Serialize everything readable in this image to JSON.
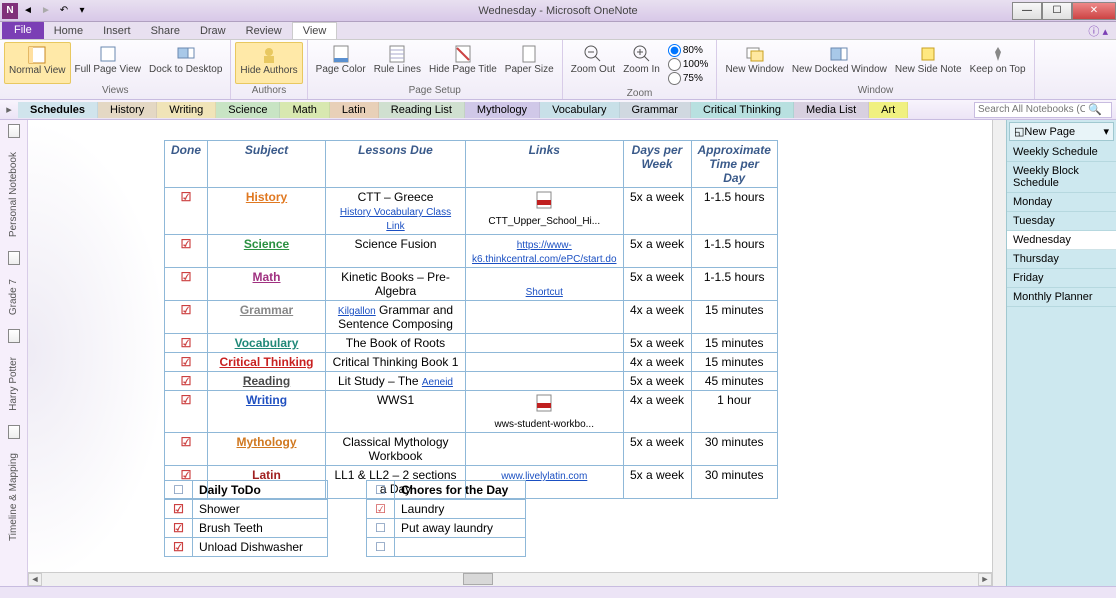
{
  "app": {
    "title": "Wednesday - Microsoft OneNote"
  },
  "qat": {
    "back_icon": "back",
    "fwd_icon": "fwd"
  },
  "ribbon_tabs": {
    "file": "File",
    "home": "Home",
    "insert": "Insert",
    "share": "Share",
    "draw": "Draw",
    "review": "Review",
    "view": "View"
  },
  "ribbon": {
    "views": {
      "normal": "Normal View",
      "fullpage": "Full Page View",
      "dock": "Dock to Desktop",
      "group": "Views"
    },
    "authors": {
      "hide": "Hide Authors",
      "group": "Authors"
    },
    "pagesetup": {
      "pagecolor": "Page Color",
      "rulelines": "Rule Lines",
      "hidetitle": "Hide Page Title",
      "papersize": "Paper Size",
      "group": "Page Setup"
    },
    "zoom": {
      "out": "Zoom Out",
      "in": "Zoom In",
      "z80": "80%",
      "z100": "100%",
      "z75": "75%",
      "group": "Zoom"
    },
    "window": {
      "newwin": "New Window",
      "docked": "New Docked Window",
      "sidenote": "New Side Note",
      "ontop": "Keep on Top",
      "group": "Window"
    }
  },
  "notebook_tabs": [
    {
      "label": "Schedules",
      "color": "#d0e4ec"
    },
    {
      "label": "History",
      "color": "#e4d8c4"
    },
    {
      "label": "Writing",
      "color": "#f0e4b8"
    },
    {
      "label": "Science",
      "color": "#c8e4c4"
    },
    {
      "label": "Math",
      "color": "#d8e8b0"
    },
    {
      "label": "Latin",
      "color": "#e8d0b8"
    },
    {
      "label": "Reading List",
      "color": "#d0e0d0"
    },
    {
      "label": "Mythology",
      "color": "#d0c8e8"
    },
    {
      "label": "Vocabulary",
      "color": "#c8e0e8"
    },
    {
      "label": "Grammar",
      "color": "#d0d8e0"
    },
    {
      "label": "Critical Thinking",
      "color": "#b8e0e0"
    },
    {
      "label": "Media List",
      "color": "#d8d0e0"
    },
    {
      "label": "Art",
      "color": "#f0f080"
    }
  ],
  "search": {
    "placeholder": "Search All Notebooks (Ctrl+E)"
  },
  "leftbar": {
    "notebooks": [
      {
        "label": "Personal Notebook"
      },
      {
        "label": "Grade 7"
      },
      {
        "label": "Harry Potter"
      },
      {
        "label": "Timeline & Mapping"
      }
    ]
  },
  "pagelist": {
    "newpage": "New Page",
    "pages": [
      "Weekly Schedule",
      "Weekly Block Schedule",
      "Monday",
      "Tuesday",
      "Wednesday",
      "Thursday",
      "Friday",
      "Monthly Planner"
    ],
    "active": "Wednesday"
  },
  "schedule": {
    "headers": {
      "done": "Done",
      "subject": "Subject",
      "lessons": "Lessons Due",
      "links": "Links",
      "days": "Days per Week",
      "time": "Approximate Time per Day"
    },
    "rows": [
      {
        "done": true,
        "subject": "History",
        "subjcolor": "#e07820",
        "lessons": "CTT – Greece",
        "lessons2": "History Vocabulary Class Link",
        "lessons2link": true,
        "link_icon": "pdf",
        "link_text": "CTT_Upper_School_Hi...",
        "days": "5x a week",
        "time": "1-1.5 hours"
      },
      {
        "done": true,
        "subject": "Science",
        "subjcolor": "#2a9040",
        "lessons": "Science Fusion",
        "link_href": "https://www-k6.thinkcentral.com/ePC/start.do",
        "days": "5x a week",
        "time": "1-1.5 hours"
      },
      {
        "done": true,
        "subject": "Math",
        "subjcolor": "#a03080",
        "lessons": "Kinetic Books – Pre-Algebra",
        "link_href2": "Shortcut",
        "days": "5x a week",
        "time": "1-1.5 hours"
      },
      {
        "done": true,
        "subject": "Grammar",
        "subjcolor": "#888",
        "lessons": "Kilgallon Grammar and Sentence Composing",
        "lessons_partlink": "Kilgallon",
        "days": "4x a week",
        "time": "15 minutes"
      },
      {
        "done": true,
        "subject": "Vocabulary",
        "subjcolor": "#208878",
        "lessons": "The Book of Roots",
        "days": "5x a week",
        "time": "15 minutes"
      },
      {
        "done": true,
        "subject": "Critical Thinking",
        "subjcolor": "#c82020",
        "lessons": "Critical Thinking Book 1",
        "days": "4x a week",
        "time": "15 minutes"
      },
      {
        "done": true,
        "subject": "Reading",
        "subjcolor": "#4a4a4a",
        "lessons": "Lit Study – The Aeneid",
        "lessons_partlink2": "Aeneid",
        "days": "5x a week",
        "time": "45 minutes"
      },
      {
        "done": true,
        "subject": "Writing",
        "subjcolor": "#2050c0",
        "lessons": "WWS1",
        "link_icon": "pdf",
        "link_text": "wws-student-workbo...",
        "days": "4x a week",
        "time": "1 hour"
      },
      {
        "done": true,
        "subject": "Mythology",
        "subjcolor": "#d07820",
        "lessons": "Classical Mythology Workbook",
        "days": "5x a week",
        "time": "30 minutes"
      },
      {
        "done": true,
        "subject": "Latin",
        "subjcolor": "#a02020",
        "lessons": "LL1 & LL2 – 2 sections a Day",
        "link_href": "www.livelylatin.com",
        "days": "5x a week",
        "time": "30 minutes"
      }
    ]
  },
  "todo": {
    "header": "Daily ToDo",
    "items": [
      {
        "done": true,
        "text": "Shower"
      },
      {
        "done": true,
        "text": "Brush Teeth"
      },
      {
        "done": true,
        "text": "Unload Dishwasher"
      }
    ]
  },
  "chores": {
    "header": "Chores for the Day",
    "items": [
      {
        "done": true,
        "text": "Laundry"
      },
      {
        "done": false,
        "text": "Put away laundry"
      },
      {
        "done": false,
        "text": ""
      }
    ]
  }
}
